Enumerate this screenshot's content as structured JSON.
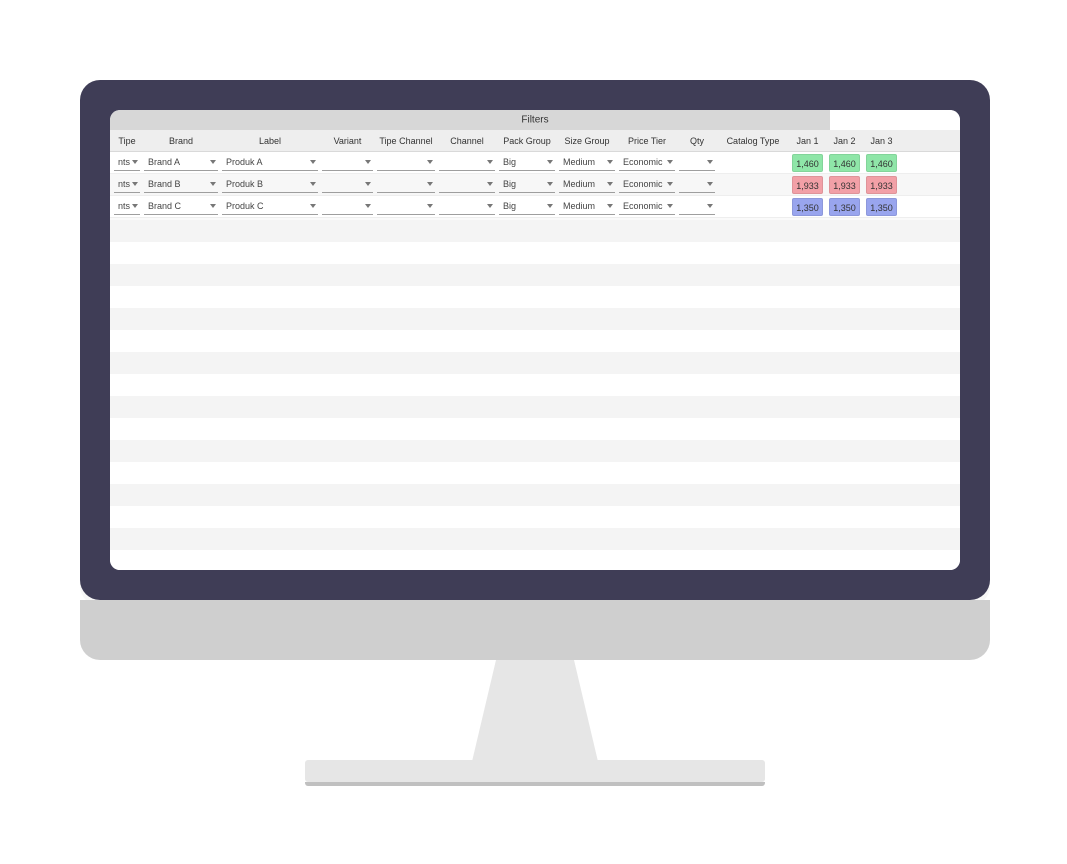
{
  "filters_band": {
    "label": "Filters"
  },
  "columns": {
    "tipe": "Tipe",
    "brand": "Brand",
    "label": "Label",
    "variant": "Variant",
    "tipe_channel": "Tipe Channel",
    "channel": "Channel",
    "pack_group": "Pack Group",
    "size_group": "Size Group",
    "price_tier": "Price Tier",
    "qty": "Qty",
    "catalog_type": "Catalog Type",
    "jan1": "Jan 1",
    "jan2": "Jan 2",
    "jan3": "Jan 3"
  },
  "rows": [
    {
      "tipe": "nts",
      "brand": "Brand A",
      "label": "Produk A",
      "variant": "",
      "tipe_channel": "",
      "channel": "",
      "pack_group": "Big",
      "size_group": "Medium",
      "price_tier": "Economic",
      "qty": "",
      "catalog_type": "",
      "jan1": "1,460",
      "jan2": "1,460",
      "jan3": "1,460",
      "value_color": "#8fe6a8"
    },
    {
      "tipe": "nts",
      "brand": "Brand B",
      "label": "Produk B",
      "variant": "",
      "tipe_channel": "",
      "channel": "",
      "pack_group": "Big",
      "size_group": "Medium",
      "price_tier": "Economic",
      "qty": "",
      "catalog_type": "",
      "jan1": "1,933",
      "jan2": "1,933",
      "jan3": "1,933",
      "value_color": "#f2a0a7"
    },
    {
      "tipe": "nts",
      "brand": "Brand C",
      "label": "Produk C",
      "variant": "",
      "tipe_channel": "",
      "channel": "",
      "pack_group": "Big",
      "size_group": "Medium",
      "price_tier": "Economic",
      "qty": "",
      "catalog_type": "",
      "jan1": "1,350",
      "jan2": "1,350",
      "jan3": "1,350",
      "value_color": "#99a5ee"
    }
  ]
}
